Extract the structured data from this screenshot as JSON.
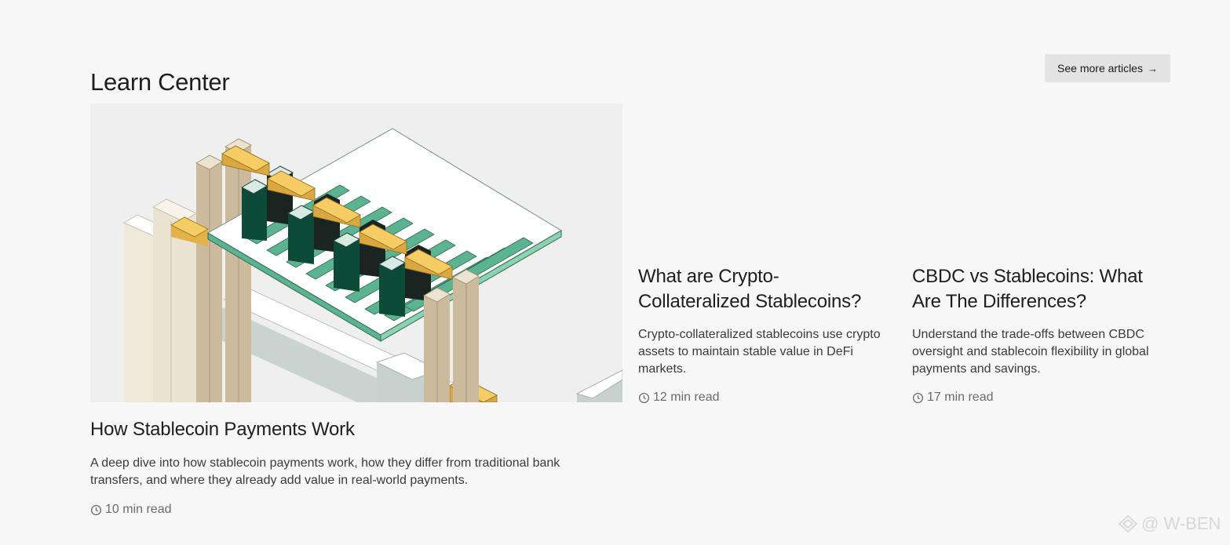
{
  "header": {
    "title": "Learn Center",
    "see_more_label": "See more articles",
    "see_more_arrow": "→"
  },
  "featured": {
    "title": "How Stablecoin Payments Work",
    "description": "A deep dive into how stablecoin payments work, how they differ from traditional bank transfers, and where they already add value in real-world payments.",
    "read_time": "10 min read",
    "image_icon": "isometric-illustration"
  },
  "articles": [
    {
      "title": "What are Crypto-Collateralized Stablecoins?",
      "description": "Crypto-collateralized stablecoins use crypto assets to maintain stable value in DeFi markets.",
      "read_time": "12 min read"
    },
    {
      "title": "CBDC vs Stablecoins: What Are The Differences?",
      "description": "Understand the trade-offs between CBDC oversight and stablecoin flexibility in global payments and savings.",
      "read_time": "17 min read"
    }
  ],
  "watermark": {
    "text": "@ W-BEN",
    "icon": "diamond-logo-icon"
  },
  "colors": {
    "background": "#f7f7f7",
    "button_bg": "#e3e3e3",
    "green": "#5bb391",
    "dark_green": "#0d4a37",
    "gold": "#f2c75c",
    "beige": "#cbbb9c"
  }
}
